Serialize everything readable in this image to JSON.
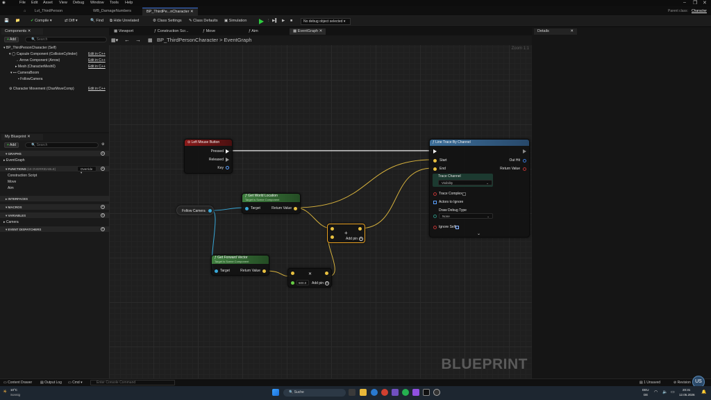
{
  "app": {
    "menu": [
      "File",
      "Edit",
      "Asset",
      "View",
      "Debug",
      "Window",
      "Tools",
      "Help"
    ],
    "parent_class_label": "Parent class:",
    "parent_class_value": "Character"
  },
  "doc_tabs": [
    "Lvl_ThirdPerson",
    "WB_DamageNumbers",
    "BP_ThirdPe...nCharacter"
  ],
  "toolbar": {
    "compile": "Compile",
    "diff": "Diff",
    "find": "Find",
    "hide_unrelated": "Hide Unrelated",
    "class_settings": "Class Settings",
    "class_defaults": "Class Defaults",
    "simulation": "Simulation",
    "debug_object": "No debug object selected"
  },
  "components_panel": {
    "title": "Components",
    "add": "Add",
    "search_placeholder": "Search",
    "items": [
      {
        "label": "BP_ThirdPersonCharacter (Self)",
        "edit": ""
      },
      {
        "label": "Capsule Component (CollisionCylinder)",
        "edit": "Edit in C++"
      },
      {
        "label": "Arrow Component (Arrow)",
        "edit": "Edit in C++"
      },
      {
        "label": "Mesh (CharacterMesh0)",
        "edit": "Edit in C++"
      },
      {
        "label": "CameraBoom",
        "edit": ""
      },
      {
        "label": "FollowCamera",
        "edit": ""
      },
      {
        "label": "Character Movement (CharMoveComp)",
        "edit": "Edit in C++"
      }
    ]
  },
  "my_blueprint": {
    "title": "My Blueprint",
    "add": "Add",
    "search_placeholder": "Search",
    "graphs_hdr": "GRAPHS",
    "graphs": [
      "EventGraph"
    ],
    "functions_hdr": "FUNCTIONS",
    "functions_note": "(19 OVERRIDABLE)",
    "override": "Override",
    "functions": [
      "Construction Script",
      "Move",
      "Aim"
    ],
    "interfaces_hdr": "INTERFACES",
    "macros_hdr": "MACROS",
    "variables_hdr": "VARIABLES",
    "variables": [
      "Camera"
    ],
    "dispatchers_hdr": "EVENT DISPATCHERS"
  },
  "editor_tabs": [
    "Viewport",
    "Construction Scr...",
    "Move",
    "Aim",
    "EventGraph"
  ],
  "breadcrumb": {
    "root": "BP_ThirdPersonCharacter",
    "sep": ">",
    "leaf": "EventGraph"
  },
  "zoom": "Zoom 1:1",
  "watermark": "BLUEPRINT",
  "details": {
    "title": "Details"
  },
  "nodes": {
    "left_mouse": {
      "title": "Left Mouse Button",
      "pins": [
        "Pressed",
        "Released",
        "Key"
      ]
    },
    "follow_camera": {
      "title": "Follow Camera"
    },
    "get_world_location": {
      "title": "Get World Location",
      "sub": "Target is Scene Component",
      "target": "Target",
      "ret": "Return Value"
    },
    "get_forward_vector": {
      "title": "Get Forward Vector",
      "sub": "Target is Scene Component",
      "target": "Target",
      "ret": "Return Value"
    },
    "add_vectors": {
      "add_pin": "Add pin",
      "plus": "+"
    },
    "multiply": {
      "value": "500.0",
      "add_pin": "Add pin"
    },
    "line_trace": {
      "title": "Line Trace By Channel",
      "start": "Start",
      "end": "End",
      "out_hit": "Out Hit",
      "return_value": "Return Value",
      "trace_channel": "Trace Channel",
      "trace_channel_value": "Visibility",
      "trace_complex": "Trace Complex",
      "actors_to_ignore": "Actors to Ignore",
      "draw_debug_type": "Draw Debug Type",
      "draw_debug_value": "None",
      "ignore_self": "Ignore Self"
    }
  },
  "statusbar": {
    "content_drawer": "Content Drawer",
    "output_log": "Output Log",
    "cmd": "Cmd",
    "console_placeholder": "Enter Console Command",
    "unsaved": "1 Unsaved",
    "revision": "Revision"
  },
  "taskbar": {
    "temp": "10°C",
    "weather": "Sonnig",
    "search": "Suche",
    "lang": "DEU",
    "lang2": "DE",
    "time": "20:31",
    "date": "12.05.2026"
  }
}
